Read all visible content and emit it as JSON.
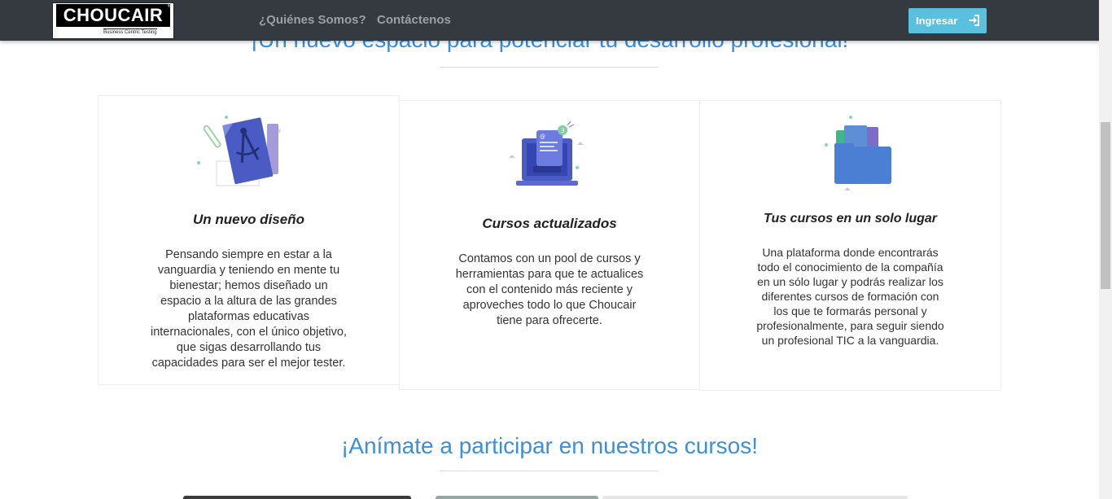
{
  "navbar": {
    "logo_text": "CHOUCAIR",
    "logo_tagline": "Business Centric Testing",
    "links": [
      "¿Quiénes Somos?",
      "Contáctenos"
    ],
    "login_label": "Ingresar",
    "login_icon": "sign-in-icon",
    "background_color": "#343a40",
    "login_color": "#5bc0de"
  },
  "sections": {
    "intro_title": "¡Un nuevo espacio para potenciar tu desarrollo profesional!",
    "courses_title": "¡Anímate a participar en nuestros cursos!",
    "title_color": "#3d8fd8"
  },
  "cards": [
    {
      "icon": "blueprint-illustration",
      "heading": "Un nuevo diseño",
      "lines": [
        "Pensando siempre en estar a la",
        "vanguardia y teniendo en mente tu",
        "bienestar; hemos diseñado un",
        "espacio a la altura de las grandes",
        "plataformas educativas",
        "internacionales, con el único objetivo,",
        "que sigas desarrollando tus",
        "capacidades para ser el mejor tester."
      ]
    },
    {
      "icon": "laptop-notification-illustration",
      "heading": "Cursos actualizados",
      "lines": [
        "Contamos con un pool de cursos y",
        "herramientas para que te actualices",
        "con el contenido más reciente y",
        "aproveches todo lo que Choucair",
        "tiene para ofrecerte."
      ]
    },
    {
      "icon": "folder-illustration",
      "heading": "Tus cursos en un solo lugar",
      "lines": [
        "Una plataforma donde encontrarás",
        "todo el conocimiento de la compañía",
        "en un sólo lugar y podrás realizar los",
        "diferentes cursos de formación con",
        "los que te formarás personal y",
        "profesionalmente, para seguir siendo",
        "un profesional TIC a la vanguardia."
      ]
    }
  ]
}
